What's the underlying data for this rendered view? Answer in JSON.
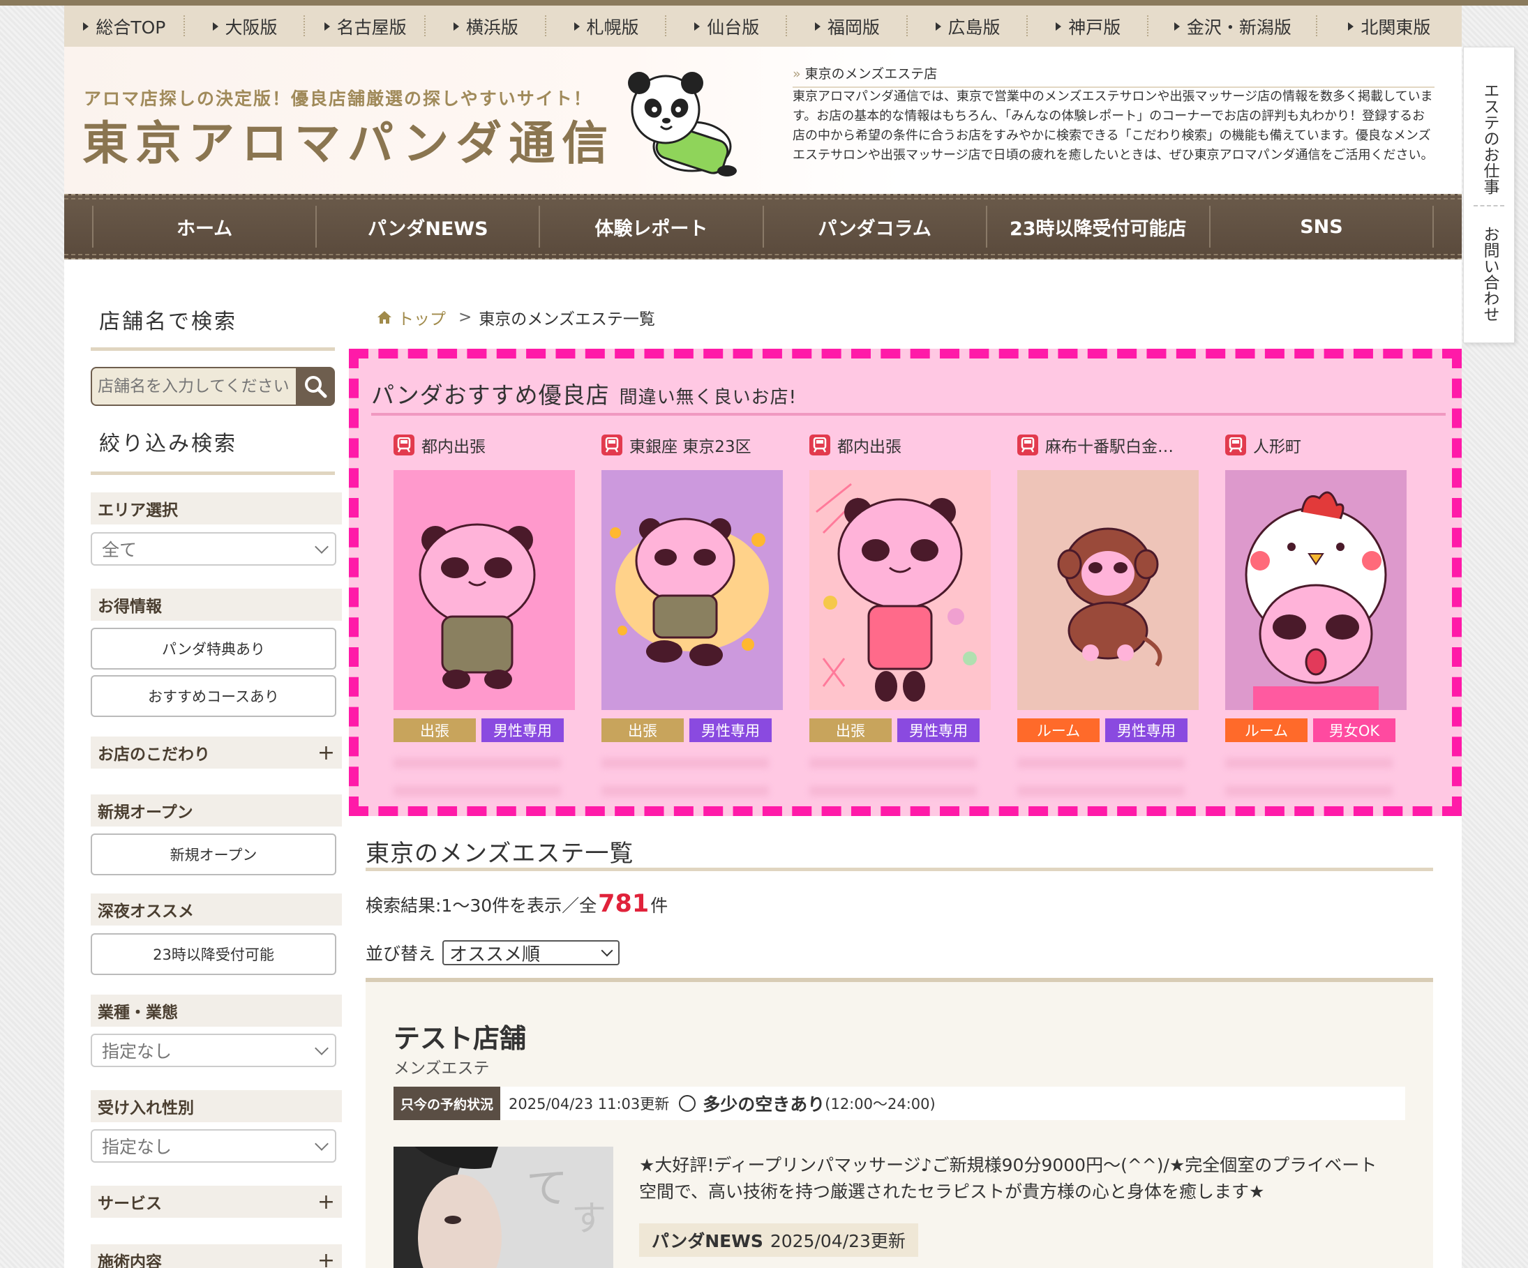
{
  "regions": [
    "総合TOP",
    "大阪版",
    "名古屋版",
    "横浜版",
    "札幌版",
    "仙台版",
    "福岡版",
    "広島版",
    "神戸版",
    "金沢・新潟版",
    "北関東版"
  ],
  "header": {
    "tagline": "アロマ店探しの決定版！優良店舗厳選の探しやすいサイト！",
    "logo": "東京アロマパンダ通信",
    "intro_title": "東京のメンズエステ店",
    "intro_body": "東京アロマパンダ通信では、東京で営業中のメンズエステサロンや出張マッサージ店の情報を数多く掲載しています。お店の基本的な情報はもちろん、「みんなの体験レポート」のコーナーでお店の評判も丸わかり！登録するお店の中から希望の条件に合うお店をすみやかに検索できる「こだわり検索」の機能も備えています。優良なメンズエステサロンや出張マッサージ店で日頃の疲れを癒したいときは、ぜひ東京アロマパンダ通信をご活用ください。"
  },
  "nav": [
    "ホーム",
    "パンダNEWS",
    "体験レポート",
    "パンダコラム",
    "23時以降受付可能店",
    "SNS"
  ],
  "sidetab": {
    "job": "エステのお仕事",
    "contact": "お問い合わせ"
  },
  "sidebar": {
    "search_heading": "店舗名で検索",
    "search_placeholder": "店舗名を入力してください",
    "filter_heading": "絞り込み検索",
    "area_label": "エリア選択",
    "area_value": "全て",
    "deals_label": "お得情報",
    "deal_btn1": "パンダ特典あり",
    "deal_btn2": "おすすめコースあり",
    "kodawari_label": "お店のこだわり",
    "new_label": "新規オープン",
    "new_btn": "新規オープン",
    "night_label": "深夜オススメ",
    "night_btn": "23時以降受付可能",
    "type_label": "業種・業態",
    "type_value": "指定なし",
    "gender_label": "受け入れ性別",
    "gender_value": "指定なし",
    "service_label": "サービス",
    "treatment_label": "施術内容"
  },
  "breadcrumb": {
    "home": "トップ",
    "current": "東京のメンズエステ一覧"
  },
  "recommended": {
    "title": "パンダおすすめ優良店",
    "subtitle": "間違い無く良いお店!",
    "cards": [
      {
        "area": "都内出張",
        "bg": "#ff99cc",
        "tags": [
          {
            "label": "出張",
            "color": "#c8a45c"
          },
          {
            "label": "男性専用",
            "color": "#8a4ae0"
          }
        ]
      },
      {
        "area": "東銀座 東京23区",
        "bg": "#cc99dd",
        "tags": [
          {
            "label": "出張",
            "color": "#c8a45c"
          },
          {
            "label": "男性専用",
            "color": "#8a4ae0"
          }
        ]
      },
      {
        "area": "都内出張",
        "bg": "#ffc4cc",
        "tags": [
          {
            "label": "出張",
            "color": "#c8a45c"
          },
          {
            "label": "男性専用",
            "color": "#8a4ae0"
          }
        ]
      },
      {
        "area": "麻布十番駅白金…",
        "bg": "#eec4b8",
        "tags": [
          {
            "label": "ルーム",
            "color": "#ff6a2a"
          },
          {
            "label": "男性専用",
            "color": "#8a4ae0"
          }
        ]
      },
      {
        "area": "人形町",
        "bg": "#dd99cc",
        "tags": [
          {
            "label": "ルーム",
            "color": "#ff6a2a"
          },
          {
            "label": "男女OK",
            "color": "#ff4aa0"
          }
        ]
      }
    ]
  },
  "list": {
    "title": "東京のメンズエステ一覧",
    "result_prefix": "検索結果:1〜30件を表示／全",
    "result_total": "781",
    "result_suffix": "件",
    "sort_label": "並び替え",
    "sort_value": "オススメ順"
  },
  "shop": {
    "name": "テスト店舗",
    "type": "メンズエステ",
    "status_label": "只今の予約状況",
    "updated": "2025/04/23 11:03更新",
    "availability": "多少の空きあり",
    "hours": "(12:00〜24:00)",
    "description": "★大好評!ディープリンパマッサージ♪ご新規様90分9000円〜(^^)/★完全個室のプライベート空間で、高い技術を持つ厳選されたセラピストが貴方様の心と身体を癒します★",
    "news_label": "パンダNEWS",
    "news_date": "2025/04/23更新"
  },
  "colors": {
    "nav_brown": "#5a4a3c",
    "rec_pink": "#ffc8e3",
    "rec_border": "#ff1aa8",
    "accent_red": "#e0223a"
  }
}
